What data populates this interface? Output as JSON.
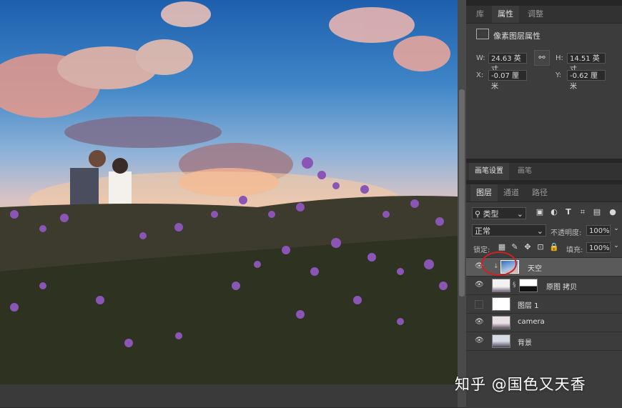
{
  "properties_panel": {
    "tabs": [
      {
        "label": "库"
      },
      {
        "label": "属性"
      },
      {
        "label": "调整"
      }
    ],
    "title": "像素图层属性",
    "w_label": "W:",
    "w_value": "24.63 英寸",
    "h_label": "H:",
    "h_value": "14.51 英寸",
    "x_label": "X:",
    "x_value": "-0.07 厘米",
    "y_label": "Y:",
    "y_value": "-0.62 厘米",
    "link_icon": "link-icon"
  },
  "history_tabs": [
    {
      "label": "画笔设置"
    },
    {
      "label": "画笔"
    }
  ],
  "layers_panel": {
    "tabs": [
      {
        "label": "图层"
      },
      {
        "label": "通道"
      },
      {
        "label": "路径"
      }
    ],
    "filter_label": "类型",
    "blend_mode": "正常",
    "opacity_label": "不透明度:",
    "opacity_value": "100%",
    "lock_label": "锁定:",
    "fill_label": "填充:",
    "fill_value": "100%",
    "layers": [
      {
        "name": "天空",
        "visible": true,
        "selected": true
      },
      {
        "name": "原图 拷贝",
        "visible": true,
        "selected": false
      },
      {
        "name": "图层 1",
        "visible": false,
        "selected": false
      },
      {
        "name": "camera",
        "visible": true,
        "selected": false
      },
      {
        "name": "背景",
        "visible": true,
        "selected": false
      }
    ]
  },
  "watermark": "知乎 @国色又天香",
  "colors": {
    "panel": "#3c3c3c",
    "selected_row": "#5a5a5a",
    "highlight_circle": "#d21f1f"
  }
}
